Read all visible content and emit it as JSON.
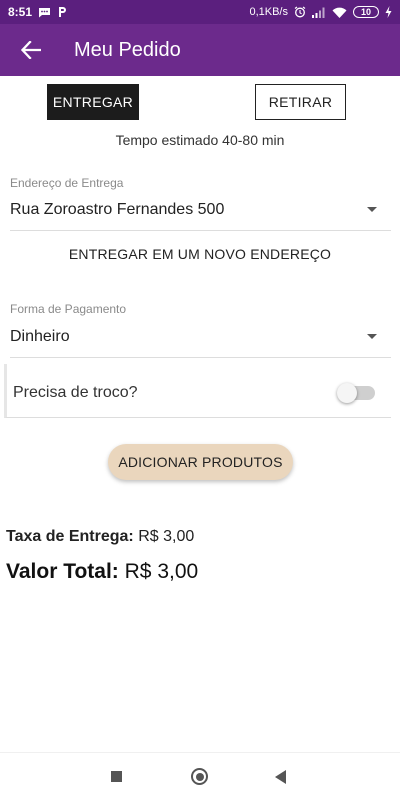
{
  "status_bar": {
    "time": "8:51",
    "network_speed": "0,1KB/s",
    "battery_level": "10",
    "icons": [
      "chat-icon",
      "parking-icon",
      "alarm-icon",
      "signal-icon",
      "wifi-icon",
      "battery-icon",
      "charging-icon"
    ]
  },
  "app_bar": {
    "title": "Meu Pedido",
    "back_icon": "arrow-left-icon",
    "color": "#6c2a8c"
  },
  "mode_toggle": {
    "deliver_label": "ENTREGAR",
    "pickup_label": "RETIRAR",
    "selected": "ENTREGAR"
  },
  "estimated_time": "Tempo estimado 40-80 min",
  "address": {
    "label": "Endereço de Entrega",
    "value": "Rua Zoroastro Fernandes 500"
  },
  "new_address_label": "ENTREGAR EM UM NOVO ENDEREÇO",
  "payment": {
    "label": "Forma de Pagamento",
    "value": "Dinheiro"
  },
  "change": {
    "label": "Precisa de troco?",
    "enabled": false
  },
  "add_products_label": "ADICIONAR PRODUTOS",
  "totals": {
    "fee_label": "Taxa de Entrega:",
    "fee_value": "R$ 3,00",
    "total_label": "Valor Total:",
    "total_value": "R$ 3,00"
  },
  "nav_bar": {
    "icons": [
      "recents-icon",
      "home-icon",
      "back-icon"
    ]
  }
}
